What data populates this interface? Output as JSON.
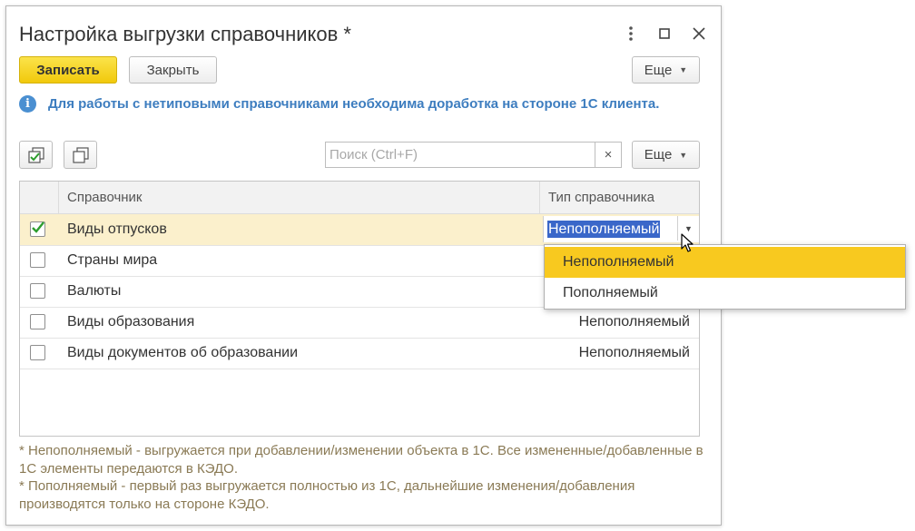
{
  "window": {
    "title": "Настройка выгрузки справочников *",
    "controls": {
      "more": "more-vertical-icon",
      "maximize": "maximize-icon",
      "close": "close-icon"
    }
  },
  "toolbar": {
    "save_label": "Записать",
    "close_label": "Закрыть",
    "more_label": "Еще"
  },
  "info": {
    "icon": "info-icon",
    "text": "Для работы с нетиповыми справочниками необходима доработка на стороне 1С клиента."
  },
  "list_toolbar": {
    "check_all_icon": "check-all-icon",
    "copy_icon": "copy-icon",
    "search_placeholder": "Поиск (Ctrl+F)",
    "search_clear": "×",
    "more_label": "Еще"
  },
  "table": {
    "columns": [
      "Справочник",
      "Тип справочника"
    ],
    "rows": [
      {
        "checked": true,
        "name": "Виды отпусков",
        "type": "Непополняемый",
        "selected": true
      },
      {
        "checked": false,
        "name": "Страны мира",
        "type": ""
      },
      {
        "checked": false,
        "name": "Валюты",
        "type": ""
      },
      {
        "checked": false,
        "name": "Виды образования",
        "type": "Непополняемый"
      },
      {
        "checked": false,
        "name": "Виды документов об образовании",
        "type": "Непополняемый"
      }
    ]
  },
  "dropdown": {
    "options": [
      "Непополняемый",
      "Пополняемый"
    ],
    "active_index": 0
  },
  "footnote": {
    "line1": "* Непополняемый - выгружается при добавлении/изменении объекта в 1С. Все измененные/добавленные в 1С элементы передаются в КЭДО.",
    "line2": "* Пополняемый - первый раз выгружается полностью из 1С, дальнейшие изменения/добавления производятся только на стороне КЭДО."
  },
  "colors": {
    "primary_button": "#f1c90c",
    "info_text": "#3d7dbf",
    "selected_row": "#fbf0cc",
    "dropdown_active": "#f8c91f",
    "selection_highlight": "#3a67c9",
    "footnote_text": "#8a7a55"
  }
}
